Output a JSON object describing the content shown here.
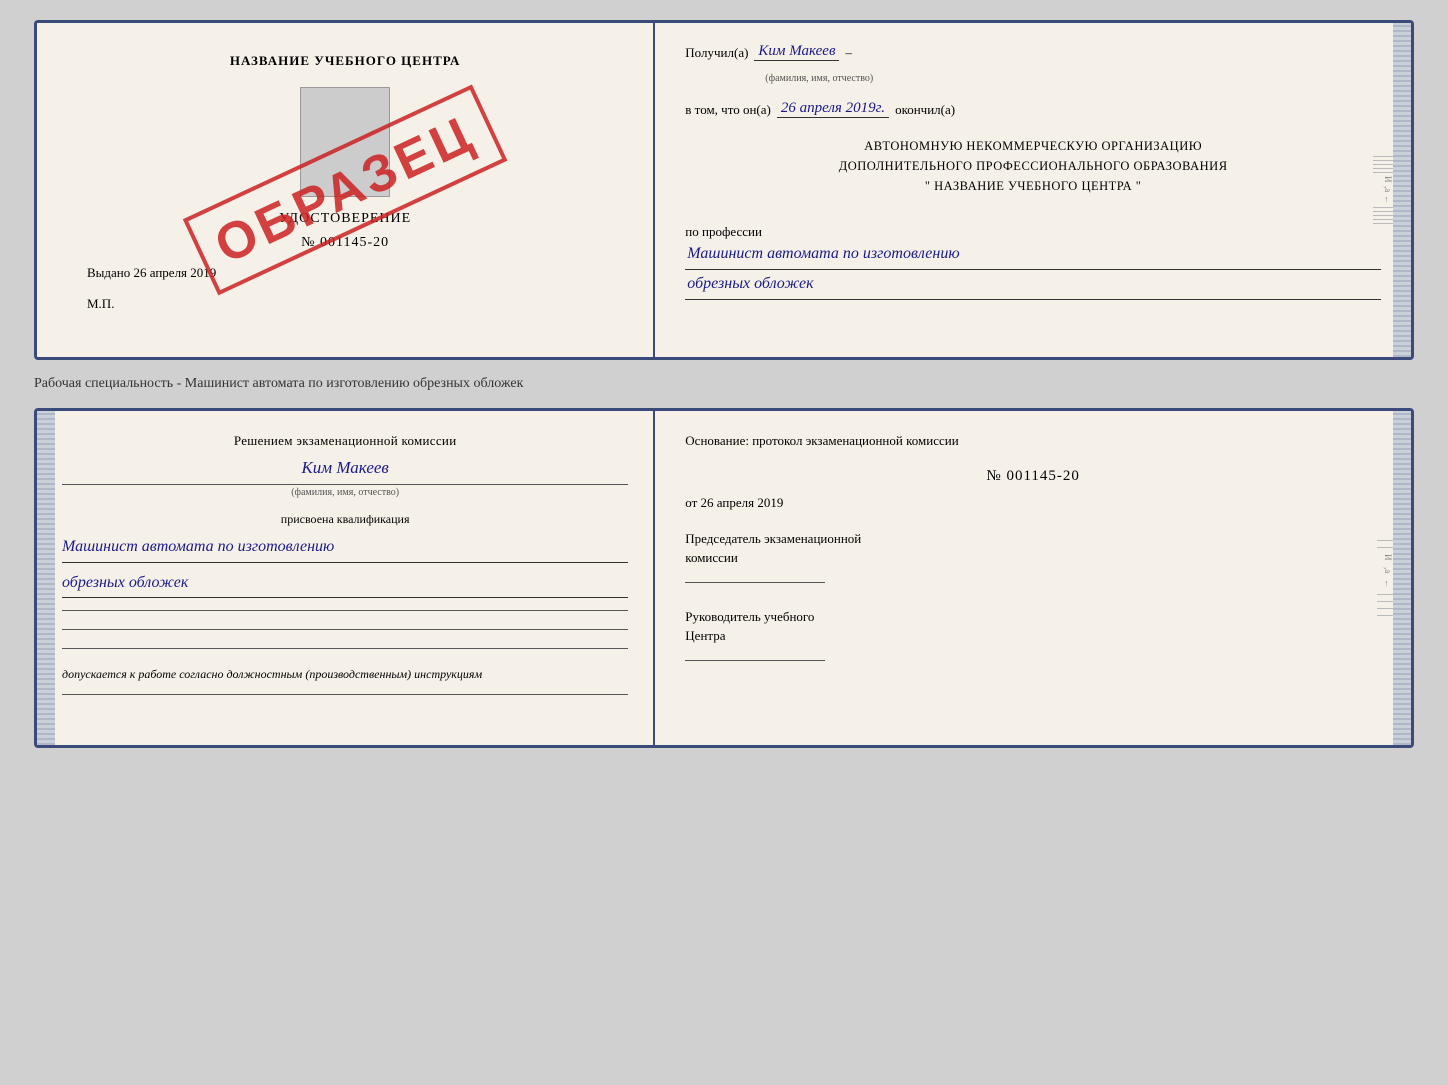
{
  "top_cert": {
    "left": {
      "school_name": "НАЗВАНИЕ УЧЕБНОГО ЦЕНТРА",
      "cert_type": "УДОСТОВЕРЕНИЕ",
      "cert_number": "№ 001145-20",
      "issued_text": "Выдано 26 апреля 2019",
      "mp_label": "М.П."
    },
    "stamp": "ОБРАЗЕЦ",
    "right": {
      "recipient_label": "Получил(а)",
      "recipient_name": "Ким Макеев",
      "fio_hint": "(фамилия, имя, отчество)",
      "date_label": "в том, что он(а)",
      "date_value": "26 апреля 2019г.",
      "finished_label": "окончил(а)",
      "org_text_1": "АВТОНОМНУЮ НЕКОММЕРЧЕСКУЮ ОРГАНИЗАЦИЮ",
      "org_text_2": "ДОПОЛНИТЕЛЬНОГО ПРОФЕССИОНАЛЬНОГО ОБРАЗОВАНИЯ",
      "org_text_3": "\"  НАЗВАНИЕ УЧЕБНОГО ЦЕНТРА  \"",
      "profession_label": "по профессии",
      "profession_line1": "Машинист автомата по изготовлению",
      "profession_line2": "обрезных обложек"
    }
  },
  "caption": "Рабочая специальность - Машинист автомата по изготовлению обрезных обложек",
  "bottom_cert": {
    "left": {
      "title_line1": "Решением экзаменационной комиссии",
      "person_name": "Ким Макеев",
      "fio_hint": "(фамилия, имя, отчество)",
      "qualification_label": "присвоена квалификация",
      "profession_line1": "Машинист автомата по изготовлению",
      "profession_line2": "обрезных обложек",
      "note_text": "допускается к  работе согласно должностным (производственным) инструкциям"
    },
    "right": {
      "basis_label": "Основание: протокол экзаменационной комиссии",
      "protocol_number": "№ 001145-20",
      "protocol_date": "от 26 апреля 2019",
      "chair_label_line1": "Председатель экзаменационной",
      "chair_label_line2": "комиссии",
      "director_label_line1": "Руководитель учебного",
      "director_label_line2": "Центра"
    }
  }
}
